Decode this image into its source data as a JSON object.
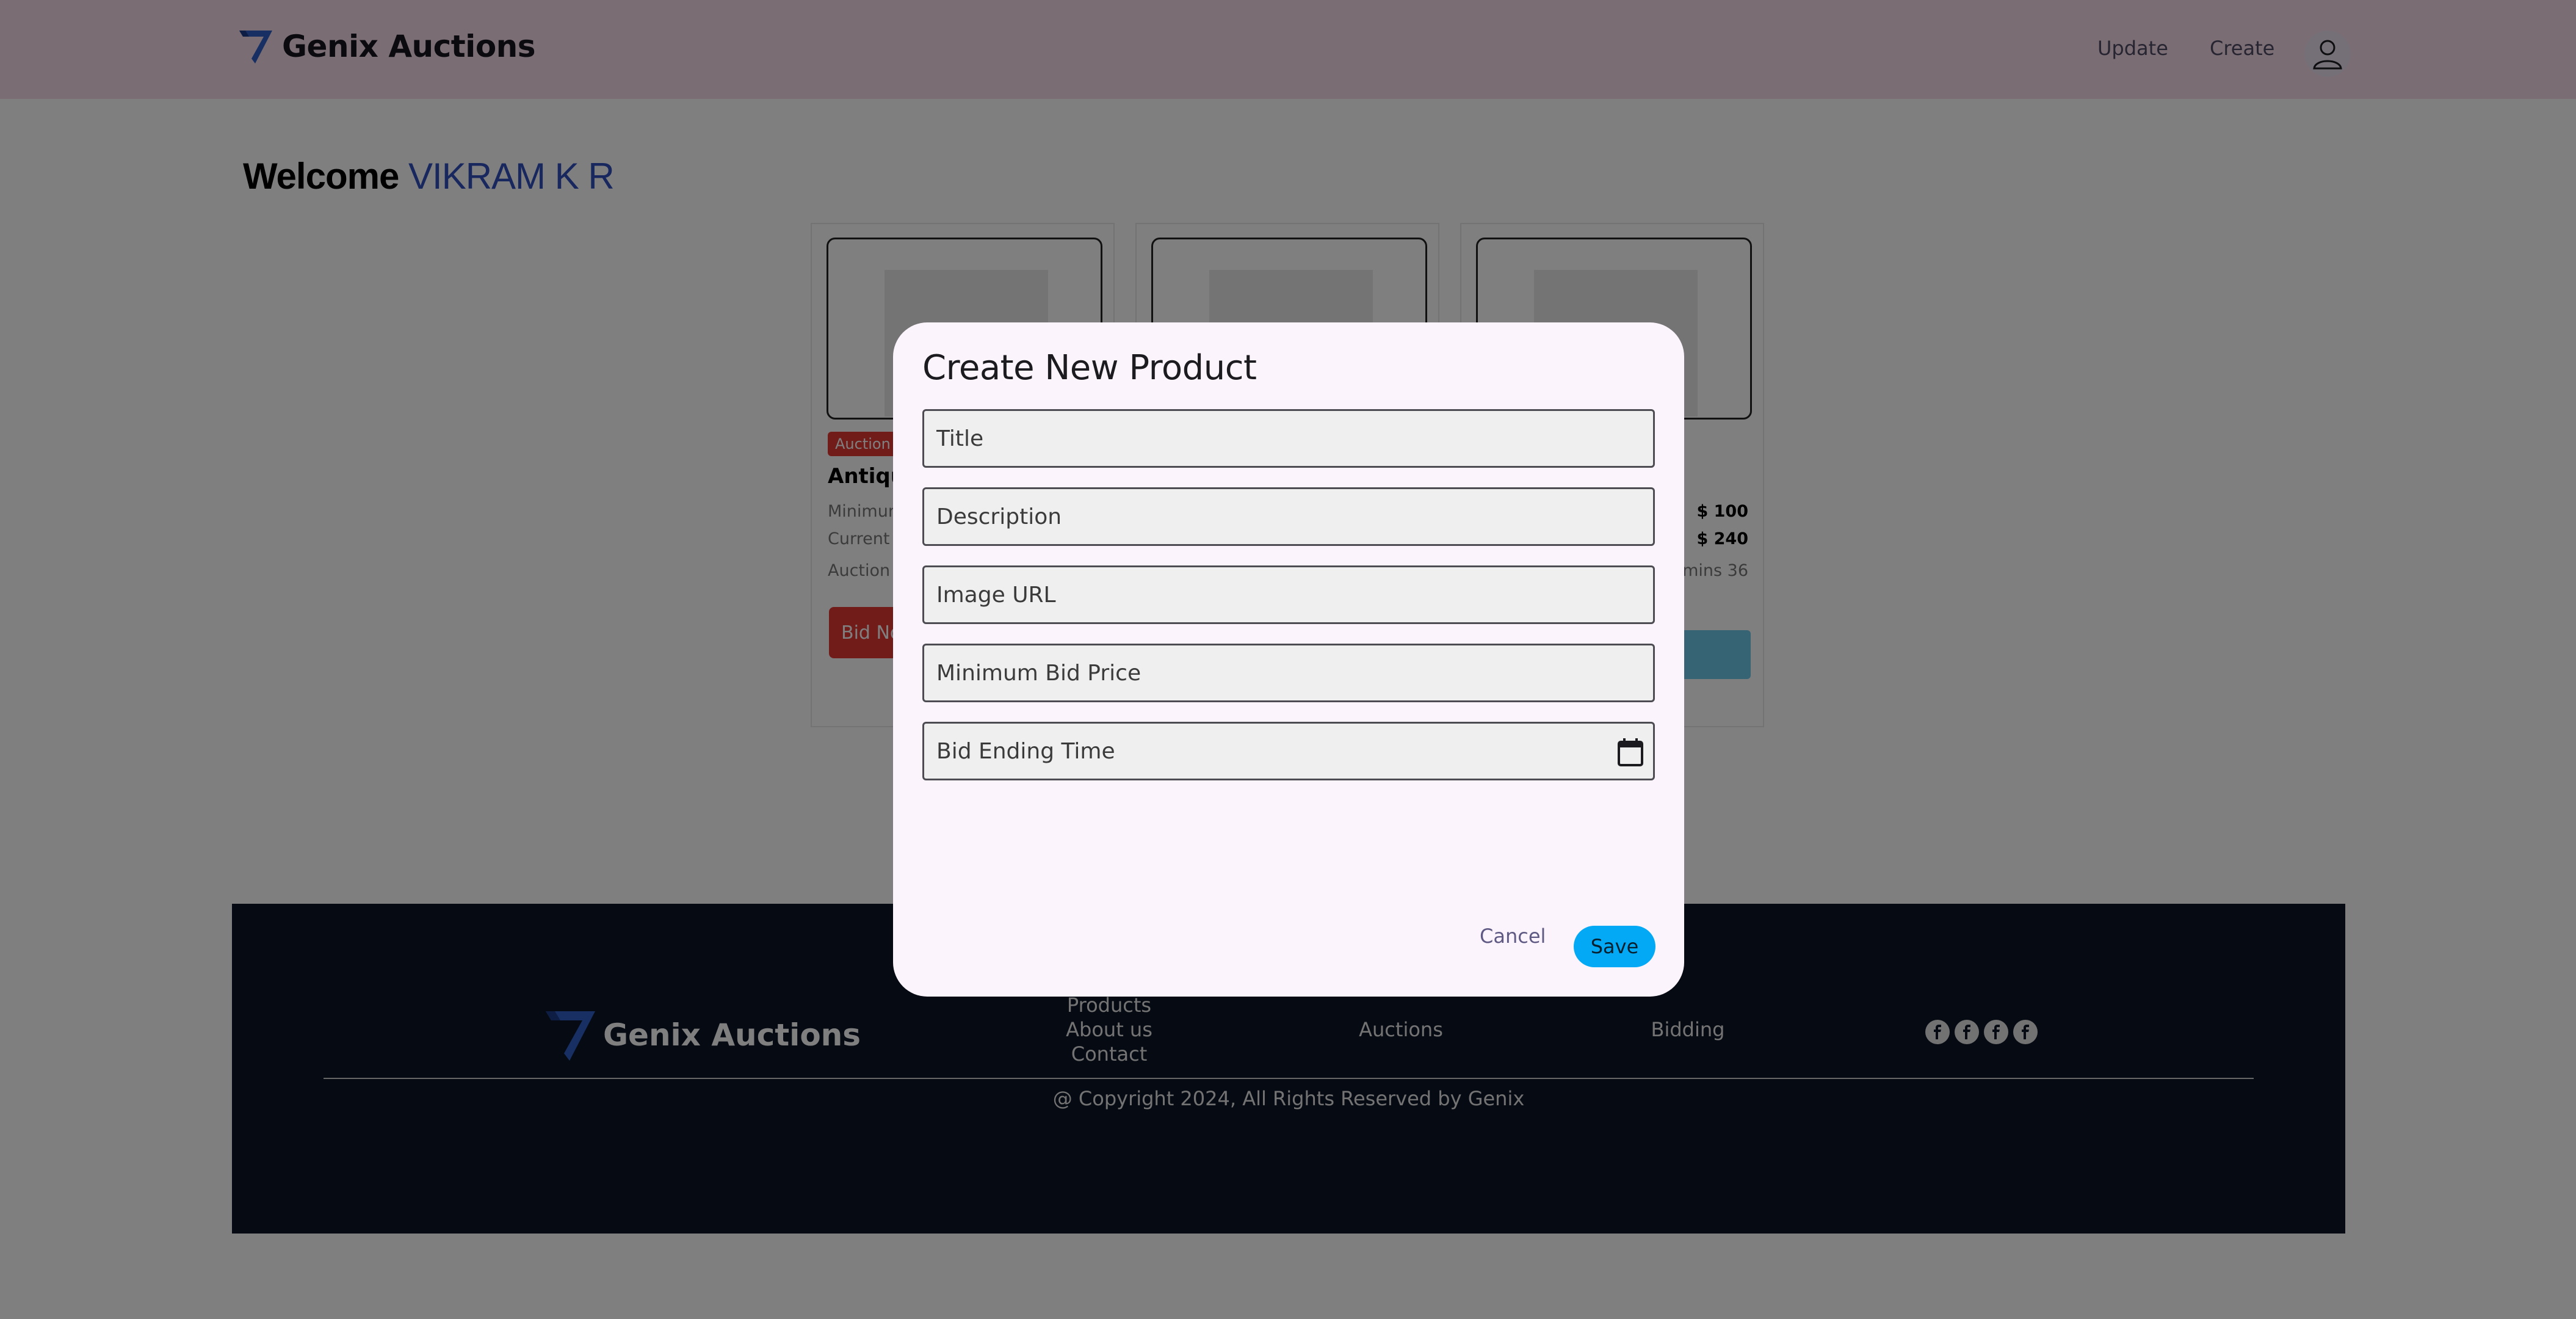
{
  "header": {
    "brand": "Genix Auctions",
    "nav": {
      "update": "Update",
      "create": "Create"
    },
    "icons": {
      "logo": "genix-logo-icon",
      "user": "user-icon"
    },
    "background": "#f5dbe8"
  },
  "welcome": {
    "prefix": "Welcome",
    "name": "VIKRAM K R"
  },
  "cards": [
    {
      "badge": "Auction",
      "name": "Antique",
      "min_label": "Minimum",
      "current_label": "Current",
      "ends_label": "Auction",
      "bid_label": "Bid No"
    },
    {
      "badge": "",
      "name": ""
    },
    {
      "min_value": "$ 100",
      "current_value": "$ 240",
      "ends_value": "mins 36"
    }
  ],
  "footer": {
    "brand": "Genix Auctions",
    "links": {
      "products": "Products",
      "about": "About us",
      "contact": "Contact",
      "auctions": "Auctions",
      "bidding": "Bidding"
    },
    "social_icons": [
      "facebook-icon",
      "facebook-icon",
      "facebook-icon",
      "facebook-icon"
    ],
    "copyright": "@ Copyright 2024, All Rights Reserved by Genix"
  },
  "modal": {
    "title": "Create New Product",
    "fields": {
      "title": {
        "placeholder": "Title",
        "value": ""
      },
      "description": {
        "placeholder": "Description",
        "value": ""
      },
      "image_url": {
        "placeholder": "Image URL",
        "value": ""
      },
      "min_bid": {
        "placeholder": "Minimum Bid Price",
        "value": ""
      },
      "end_time": {
        "placeholder": "Bid Ending Time",
        "value": ""
      }
    },
    "cancel_label": "Cancel",
    "save_label": "Save",
    "colors": {
      "save": "#03a9f4",
      "surface": "#fcf4fc"
    }
  }
}
